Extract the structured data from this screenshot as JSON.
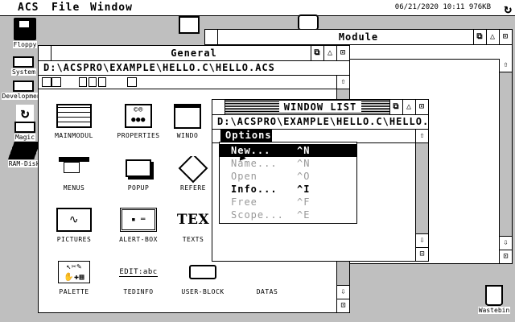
{
  "menubar": {
    "items": [
      "ACS",
      "File",
      "Window"
    ],
    "status": "06/21/2020 10:11 976KB"
  },
  "desktop_icons": [
    {
      "label": "Floppy"
    },
    {
      "label": "System"
    },
    {
      "label": "Development"
    },
    {
      "label": "Magic"
    },
    {
      "label": "RAM-Disk"
    },
    {
      "label": "Wastebin"
    }
  ],
  "module_window": {
    "title": "Module"
  },
  "general_window": {
    "title": "General",
    "path": "D:\\ACSPRO\\EXAMPLE\\HELLO.C\\HELLO.ACS",
    "icons": [
      "MAINMODUL",
      "PROPERTIES",
      "WINDO",
      "MENUS",
      "POPUP",
      "REFERE",
      "PICTURES",
      "ALERT-BOX",
      "TEXTS",
      "PALETTE",
      "TEDINFO",
      "USER-BLOCK",
      "DATAS"
    ],
    "tedinfo_sample": "EDIT:abc",
    "texts_sample": "TEX"
  },
  "window_list": {
    "title": "WINDOW LIST",
    "path": "D:\\ACSPRO\\EXAMPLE\\HELLO.C\\HELLO."
  },
  "options_menu": {
    "title": "Options",
    "items": [
      {
        "label": "New...",
        "key": "^N",
        "enabled": true,
        "selected": true
      },
      {
        "label": "Name...",
        "key": "^N",
        "enabled": false
      },
      {
        "label": "Open",
        "key": "^O",
        "enabled": false
      },
      {
        "label": "Info...",
        "key": "^I",
        "enabled": true
      },
      {
        "label": "Free",
        "key": "^F",
        "enabled": false
      },
      {
        "label": "Scope...",
        "key": "^E",
        "enabled": false
      }
    ]
  }
}
